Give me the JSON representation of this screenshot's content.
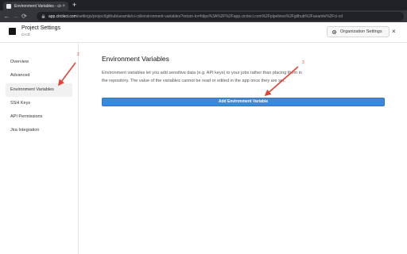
{
  "browser": {
    "tab_title": "Environment Variables - ci-cd",
    "tab_close": "×",
    "new_tab": "+",
    "back": "←",
    "forward": "→",
    "reload": "⟳",
    "url_host": "app.circleci.com",
    "url_rest": "/settings/project/github/ueamle/ci-cd/environment-variables?return-to=https%3A%2F%2Fapp.circleci.com%2Fpipelines%2Fgithub%2Fueamle%2Fci-cd"
  },
  "header": {
    "title": "Project Settings",
    "subtitle": "ci-cd",
    "org_settings_label": "Organization Settings",
    "close": "×"
  },
  "sidebar": {
    "items": [
      {
        "label": "Overview",
        "active": false
      },
      {
        "label": "Advanced",
        "active": false
      },
      {
        "label": "Environment Variables",
        "active": true
      },
      {
        "label": "SSH Keys",
        "active": false
      },
      {
        "label": "API Permissions",
        "active": false
      },
      {
        "label": "Jira Integration",
        "active": false
      }
    ]
  },
  "main": {
    "title": "Environment Variables",
    "description": "Environment variables let you add sensitive data (e.g. API keys) to your jobs rather than placing them in the repository. The value of the variables cannot be read or edited in the app once they are set.",
    "add_button_label": "Add Environment Variable"
  },
  "annotations": {
    "step_2": "2",
    "step_3": "3",
    "arrow_color": "#e34234"
  },
  "colors": {
    "primary_button": "#3b88dd",
    "browser_dark": "#202124"
  }
}
